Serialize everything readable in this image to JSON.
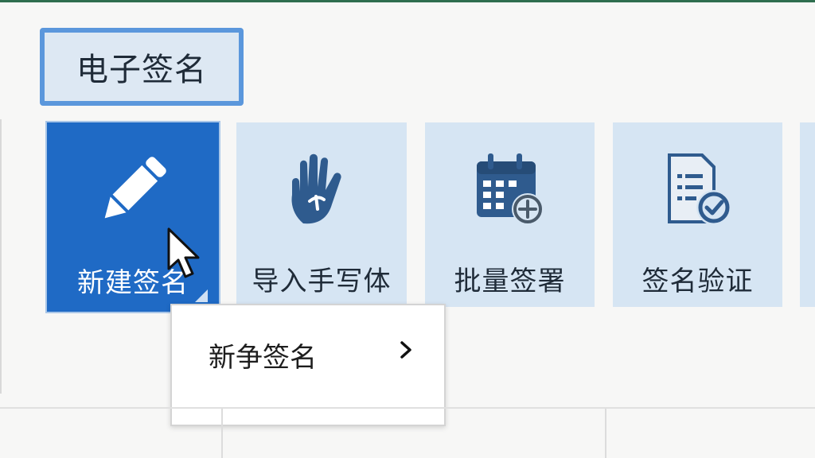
{
  "ribbon": {
    "group_label": "电子签名",
    "buttons": [
      {
        "label": "新建签名",
        "icon": "pencil-icon",
        "state": "active"
      },
      {
        "label": "导入手写体",
        "icon": "hand-icon"
      },
      {
        "label": "批量签署",
        "icon": "calendar-add-icon"
      },
      {
        "label": "签名验证",
        "icon": "document-check-icon"
      }
    ]
  },
  "dropdown": {
    "items": [
      {
        "label": "新争签名",
        "icon": "chevron-right-icon"
      }
    ]
  },
  "colors": {
    "accent": "#1f6ac5",
    "tile_bg": "#d6e5f3",
    "icon_dark": "#2f5b8e",
    "tab_border": "#5b97dc"
  }
}
